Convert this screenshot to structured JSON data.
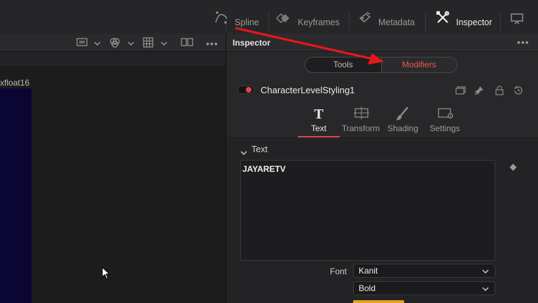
{
  "toolbar": {
    "spline_label": "Spline",
    "keyframes_label": "Keyframes",
    "metadata_label": "Metadata",
    "inspector_label": "Inspector"
  },
  "viewer": {
    "image_label": "xfloat16"
  },
  "inspector": {
    "title": "Inspector",
    "more": "•••",
    "tools_label": "Tools",
    "modifiers_label": "Modifiers",
    "tool_name": "CharacterLevelStyling1",
    "tabs": [
      {
        "label": "Text",
        "icon": "text-icon"
      },
      {
        "label": "Transform",
        "icon": "transform-icon"
      },
      {
        "label": "Shading",
        "icon": "shading-icon"
      },
      {
        "label": "Settings",
        "icon": "settings-icon"
      }
    ],
    "section_title": "Text",
    "text_value": "JAYARETV",
    "font_label": "Font",
    "font_value": "Kanit",
    "style_value": "Bold"
  },
  "colors": {
    "accent": "#e04848",
    "modifier_text": "#e85a4f",
    "annotation_arrow": "#e8161c",
    "viewer_image": "#0b0533",
    "color_swatch": "#e6a21e"
  }
}
